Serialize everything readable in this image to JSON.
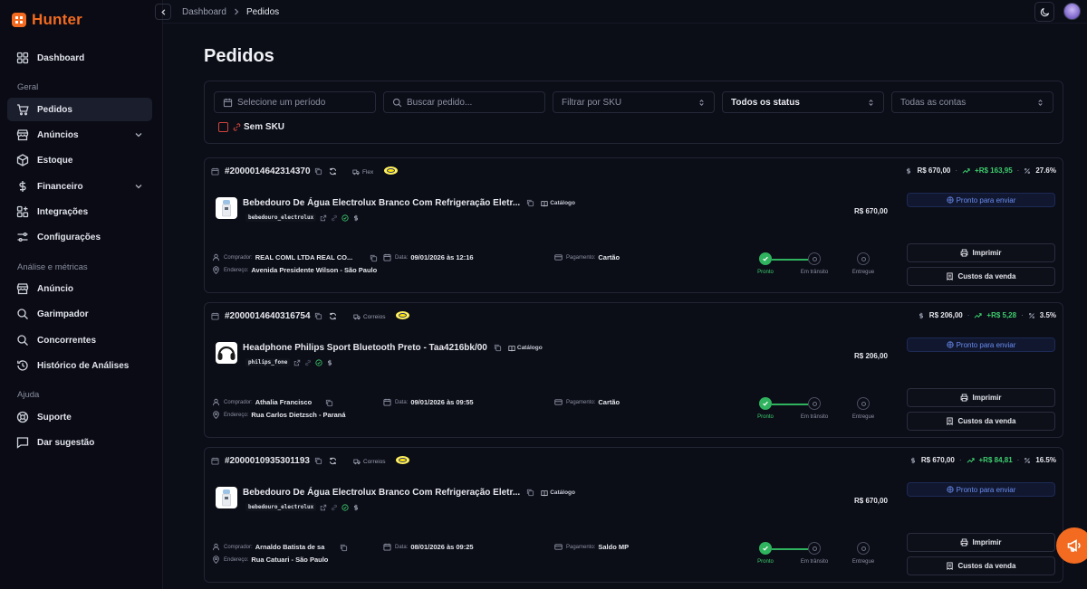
{
  "app": {
    "name": "Hunter"
  },
  "sidebar": {
    "top": [
      {
        "label": "Dashboard",
        "icon": "dashboard-icon"
      }
    ],
    "sections": [
      {
        "title": "Geral",
        "items": [
          {
            "label": "Pedidos",
            "icon": "cart-icon",
            "active": true
          },
          {
            "label": "Anúncios",
            "icon": "store-icon",
            "expandable": true
          },
          {
            "label": "Estoque",
            "icon": "package-icon"
          },
          {
            "label": "Financeiro",
            "icon": "dollar-icon",
            "expandable": true
          },
          {
            "label": "Integrações",
            "icon": "puzzle-icon"
          },
          {
            "label": "Configurações",
            "icon": "sliders-icon"
          }
        ]
      },
      {
        "title": "Análise e métricas",
        "items": [
          {
            "label": "Anúncio",
            "icon": "store-icon"
          },
          {
            "label": "Garimpador",
            "icon": "search-icon"
          },
          {
            "label": "Concorrentes",
            "icon": "search-icon"
          },
          {
            "label": "Histórico de Análises",
            "icon": "history-icon"
          }
        ]
      },
      {
        "title": "Ajuda",
        "items": [
          {
            "label": "Suporte",
            "icon": "lifebuoy-icon"
          },
          {
            "label": "Dar sugestão",
            "icon": "message-icon"
          }
        ]
      }
    ]
  },
  "breadcrumb": {
    "parent": "Dashboard",
    "current": "Pedidos"
  },
  "page": {
    "title": "Pedidos"
  },
  "filters": {
    "period_placeholder": "Selecione um período",
    "search_placeholder": "Buscar pedido...",
    "sku_filter": "Filtrar por SKU",
    "status_filter": "Todos os status",
    "accounts_filter": "Todas as contas",
    "no_sku_label": "Sem SKU"
  },
  "labels": {
    "buyer": "Comprador:",
    "address": "Endereço:",
    "date": "Data:",
    "payment": "Pagamento:",
    "catalog": "Catálogo",
    "ready_to_ship": "Pronto para enviar",
    "print": "Imprimir",
    "sale_costs": "Custos da venda",
    "steps": [
      "Pronto",
      "Em trânsito",
      "Entregue"
    ]
  },
  "orders": [
    {
      "id": "#2000014642314370",
      "shipping": "Flex",
      "total": "R$ 670,00",
      "profit": "+R$ 163,95",
      "margin": "27.6%",
      "product": "Bebedouro De Água Electrolux Branco Com Refrigeração Eletr...",
      "sku": "bebedouro_electrolux",
      "item_price": "R$ 670,00",
      "buyer": "REAL COML LTDA REAL CO...",
      "date": "09/01/2026 às 12:16",
      "payment": "Cartão",
      "address": "Avenida Presidente Wilson - São Paulo",
      "thumb": "water-cooler"
    },
    {
      "id": "#2000014640316754",
      "shipping": "Correios",
      "total": "R$ 206,00",
      "profit": "+R$ 5,28",
      "margin": "3.5%",
      "product": "Headphone Philips Sport Bluetooth Preto - Taa4216bk/00",
      "sku": "philips_fone",
      "item_price": "R$ 206,00",
      "buyer": "Athalia Francisco",
      "date": "09/01/2026 às 09:55",
      "payment": "Cartão",
      "address": "Rua Carlos Dietzsch - Paraná",
      "thumb": "headphone"
    },
    {
      "id": "#2000010935301193",
      "shipping": "Correios",
      "total": "R$ 670,00",
      "profit": "+R$ 84,81",
      "margin": "16.5%",
      "product": "Bebedouro De Água Electrolux Branco Com Refrigeração Eletr...",
      "sku": "bebedouro_electrolux",
      "item_price": "R$ 670,00",
      "buyer": "Arnaldo Batista de sa",
      "date": "08/01/2026 às 09:25",
      "payment": "Saldo MP",
      "address": "Rua Catuari - São Paulo",
      "thumb": "water-cooler"
    }
  ],
  "colors": {
    "accent": "#f26b21",
    "success": "#3ecf6e",
    "link": "#6b8df2",
    "background": "#0b0d17"
  }
}
